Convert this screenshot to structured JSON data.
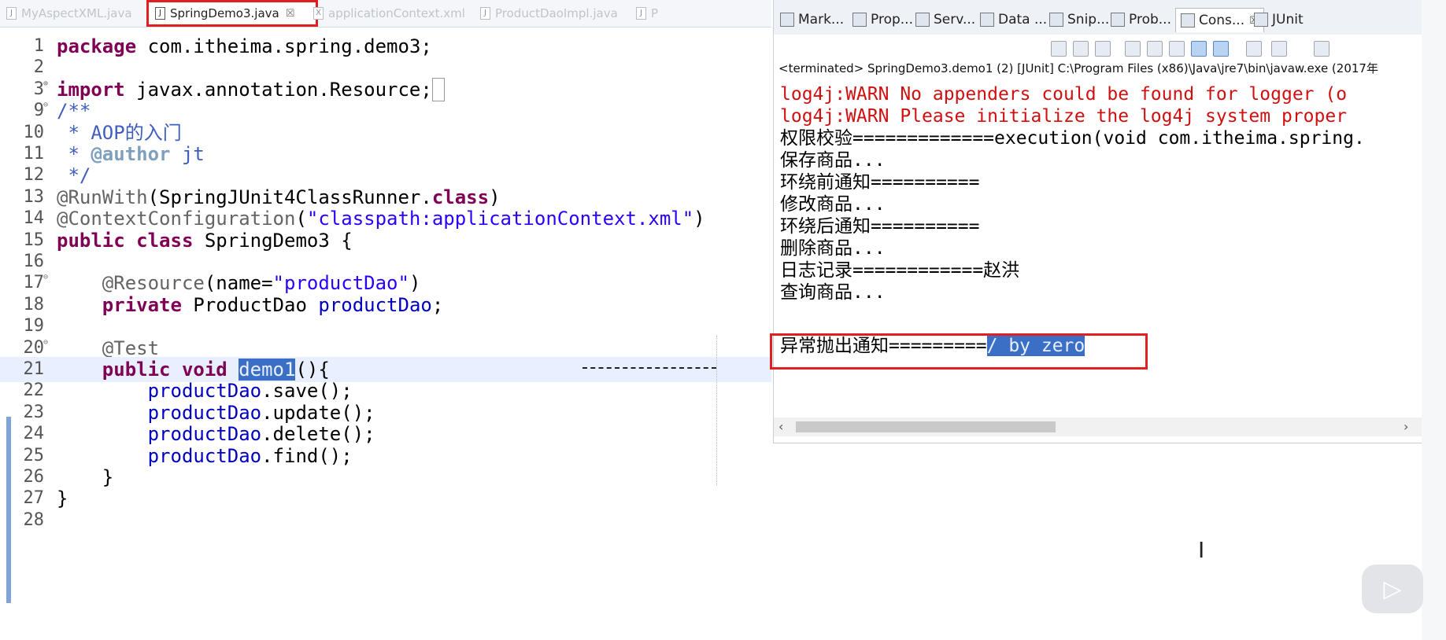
{
  "editor_tabs": [
    {
      "label": "MyAspectXML.java",
      "active": false,
      "close": ""
    },
    {
      "label": "SpringDemo3.java",
      "active": true,
      "close": "☒"
    },
    {
      "label": "applicationContext.xml",
      "active": false,
      "close": ""
    },
    {
      "label": "ProductDaoImpl.java",
      "active": false,
      "close": ""
    },
    {
      "label": "P",
      "active": false,
      "close": ""
    }
  ],
  "code_lines": [
    {
      "n": "1",
      "fold": "",
      "html": "<span class='kw'>package</span> com.itheima.spring.demo3;"
    },
    {
      "n": "2",
      "fold": "",
      "html": ""
    },
    {
      "n": "3",
      "fold": "⊕",
      "html": "<span class='kw'>import</span> javax.annotation.Resource;<span style='border:1px solid #999;'>&nbsp;</span>"
    },
    {
      "n": "9",
      "fold": "⊖",
      "html": "<span class='jd'>/**</span>"
    },
    {
      "n": "10",
      "fold": "",
      "html": "<span class='jd'> * AOP的入门</span>"
    },
    {
      "n": "11",
      "fold": "",
      "html": "<span class='jd'> * </span><span class='tag'>@author</span><span class='jd'> jt</span>"
    },
    {
      "n": "12",
      "fold": "",
      "html": "<span class='jd'> */</span>"
    },
    {
      "n": "13",
      "fold": "",
      "html": "<span class='ann'>@RunWith</span>(SpringJUnit4ClassRunner.<span class='kw'>class</span>)"
    },
    {
      "n": "14",
      "fold": "",
      "html": "<span class='ann'>@ContextConfiguration</span>(<span class='str'>\"classpath:applicationContext.xml\"</span>)"
    },
    {
      "n": "15",
      "fold": "",
      "html": "<span class='kw'>public</span> <span class='kw'>class</span> SpringDemo3 {"
    },
    {
      "n": "16",
      "fold": "",
      "html": ""
    },
    {
      "n": "17",
      "fold": "⊖",
      "html": "    <span class='ann'>@Resource</span>(name=<span class='str'>\"productDao\"</span>)"
    },
    {
      "n": "18",
      "fold": "",
      "html": "    <span class='kw'>private</span> ProductDao <span class='fld'>productDao</span>;"
    },
    {
      "n": "19",
      "fold": "",
      "html": ""
    },
    {
      "n": "20",
      "fold": "⊖",
      "html": "    <span class='ann'>@Test</span>"
    },
    {
      "n": "21",
      "fold": "",
      "html": "    <span class='kw'>public</span> <span class='kw'>void</span> <span class='hl'>demo1</span>(){",
      "current": true
    },
    {
      "n": "22",
      "fold": "",
      "html": "        <span class='fld'>productDao</span>.save();"
    },
    {
      "n": "23",
      "fold": "",
      "html": "        <span class='fld'>productDao</span>.update();"
    },
    {
      "n": "24",
      "fold": "",
      "html": "        <span class='fld'>productDao</span>.delete();"
    },
    {
      "n": "25",
      "fold": "",
      "html": "        <span class='fld'>productDao</span>.find();"
    },
    {
      "n": "26",
      "fold": "",
      "html": "    }"
    },
    {
      "n": "27",
      "fold": "",
      "html": "}"
    },
    {
      "n": "28",
      "fold": "",
      "html": ""
    }
  ],
  "panel_tabs": [
    {
      "label": "Mark...",
      "icon": "markers-icon"
    },
    {
      "label": "Prop...",
      "icon": "properties-icon"
    },
    {
      "label": "Serv...",
      "icon": "servers-icon"
    },
    {
      "label": "Data ...",
      "icon": "data-source-icon"
    },
    {
      "label": "Snip...",
      "icon": "snippets-icon"
    },
    {
      "label": "Prob...",
      "icon": "problems-icon"
    },
    {
      "label": "Cons...",
      "icon": "console-icon",
      "active": true,
      "close": "☒"
    },
    {
      "label": "JUnit",
      "icon": "junit-icon"
    }
  ],
  "console": {
    "terminated": "<terminated> SpringDemo3.demo1 (2) [JUnit] C:\\Program Files (x86)\\Java\\jre7\\bin\\javaw.exe (2017年",
    "lines": [
      {
        "text": "log4j:WARN No appenders could be found for logger (o",
        "red": true
      },
      {
        "text": "log4j:WARN Please initialize the log4j system proper",
        "red": true
      },
      {
        "text": "权限校验=============execution(void com.itheima.spring.",
        "red": false
      },
      {
        "text": "保存商品...",
        "red": false
      },
      {
        "text": "环绕前通知==========",
        "red": false
      },
      {
        "text": "修改商品...",
        "red": false
      },
      {
        "text": "环绕后通知==========",
        "red": false
      },
      {
        "text": "删除商品...",
        "red": false
      },
      {
        "text": "日志记录============赵洪",
        "red": false
      },
      {
        "text": "查询商品...",
        "red": false
      }
    ],
    "exception_prefix": "异常抛出通知=========",
    "exception_selected": "/ by zero"
  },
  "colors": {
    "highlight_box": "#e02020",
    "selection": "#3b6fc6",
    "stderr": "#d01010"
  }
}
